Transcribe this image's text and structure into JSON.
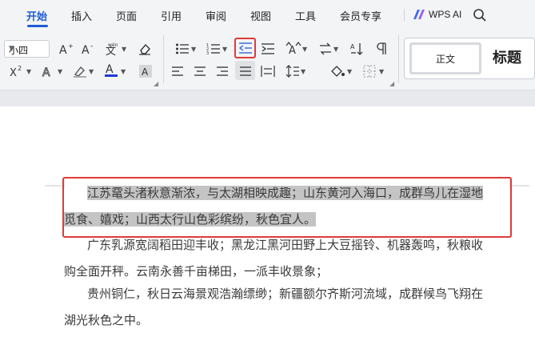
{
  "menu": {
    "items": [
      "开始",
      "插入",
      "页面",
      "引用",
      "审阅",
      "视图",
      "工具",
      "会员专享"
    ],
    "active": "开始",
    "wps_ai": "WPS AI"
  },
  "ribbon": {
    "font_size": "小四",
    "style_normal": "正文",
    "style_title": "标题"
  },
  "document": {
    "paragraphs": [
      {
        "lines": [
          "江苏鼋头渚秋意渐浓，与太湖相映成趣；山东黄河入海口，成群鸟儿在湿地",
          "觅食、嬉戏；山西太行山色彩缤纷，秋色宜人。"
        ],
        "selected": true
      },
      {
        "lines": [
          "广东乳源宽阔稻田迎丰收；黑龙江黑河田野上大豆摇铃、机器轰鸣，秋粮收",
          "购全面开秤。云南永善千亩梯田，一派丰收景象；"
        ],
        "selected": false
      },
      {
        "lines": [
          "贵州铜仁，秋日云海景观浩瀚缥缈；新疆额尔齐斯河流域，成群候鸟飞翔在",
          "湖光秋色之中。"
        ],
        "selected": false
      }
    ]
  },
  "colors": {
    "accent": "#1e5bd6",
    "annotation_red": "#e03a3a",
    "selection": "#c4c4c4",
    "font_color_bar": "#1e3bd6"
  }
}
